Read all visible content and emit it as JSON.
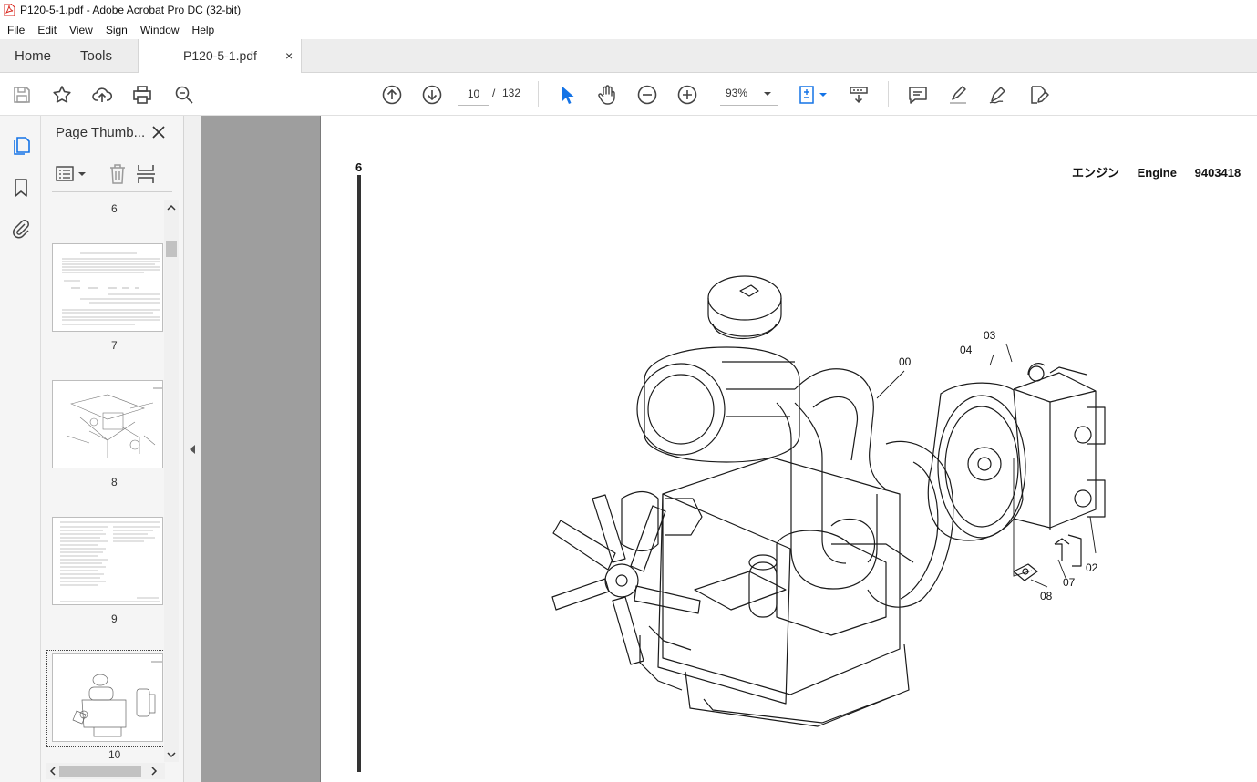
{
  "window": {
    "title": "P120-5-1.pdf - Adobe Acrobat Pro DC (32-bit)"
  },
  "menu": [
    "File",
    "Edit",
    "View",
    "Sign",
    "Window",
    "Help"
  ],
  "tabs": {
    "home": "Home",
    "tools": "Tools",
    "document": "P120-5-1.pdf",
    "close": "×"
  },
  "toolbar": {
    "current_page": "10",
    "page_separator": "/",
    "total_pages": "132",
    "zoom": "93%"
  },
  "thumbnails": {
    "title": "Page Thumb...",
    "pages": [
      {
        "label": "6"
      },
      {
        "label": "7"
      },
      {
        "label": "8"
      },
      {
        "label": "9"
      },
      {
        "label": "10",
        "selected": true
      }
    ]
  },
  "document": {
    "side_number": "6",
    "header_jp": "エンジン",
    "header_en": "Engine",
    "header_code": "9403418",
    "callouts": [
      "00",
      "02",
      "03",
      "04",
      "07",
      "08"
    ]
  },
  "colors": {
    "accent": "#1473e6",
    "pdf_red": "#d9261c",
    "canvas_gray": "#9e9e9e"
  }
}
